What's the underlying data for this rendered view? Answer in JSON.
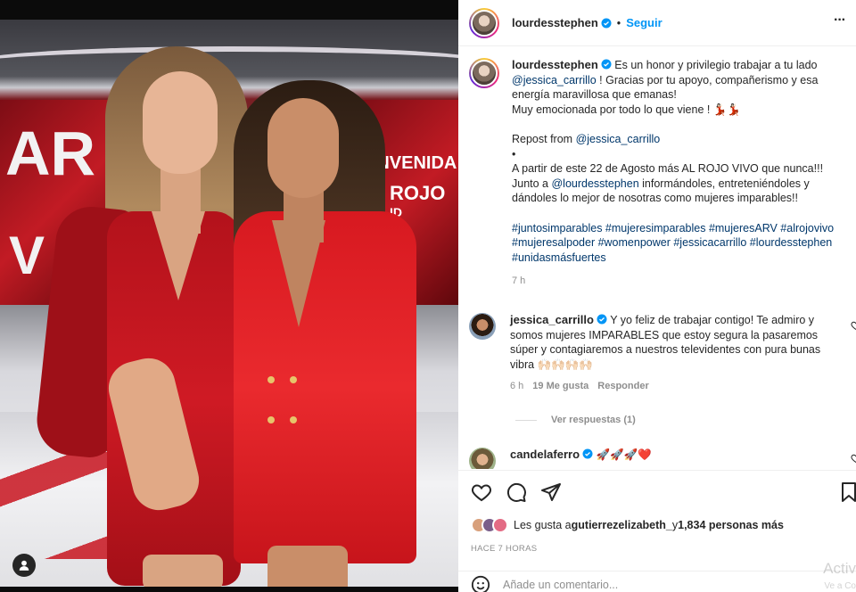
{
  "photo": {
    "screen_left_text": "AR",
    "screen_left_text2": "V",
    "screen_right_text": "ENVENIDA",
    "screen_right_text2": "ROJO",
    "screen_right_text3": "ID"
  },
  "header": {
    "username": "lourdesstephen",
    "separator": "•",
    "follow_label": "Seguir",
    "more_label": "···"
  },
  "caption": {
    "username": "lourdesstephen",
    "line1_text": " Es un honor y privilegio trabajar a tu lado",
    "line2_mention": "@jessica_carrillo",
    "line2_text": " ! Gracias por tu apoyo, compañerismo y esa",
    "line3": "energía maravillosa que emanas!",
    "line4": "Muy emocionada por todo lo que viene ! 💃🏻💃🏻",
    "line5": "",
    "line6_text": "Repost from ",
    "line6_mention": "@jessica_carrillo",
    "line7": "•",
    "line8": "A partir de este 22 de Agosto más AL ROJO VIVO que nunca!!!",
    "line9_text1": "Junto a ",
    "line9_mention": "@lourdesstephen",
    "line9_text2": " informándoles, entreteniéndoles y",
    "line10": "dándoles lo mejor de nosotras como mujeres imparables!!",
    "line11": "",
    "hashtags_line1": "#juntosimparables #mujeresimparables #mujeresARV #alrojovivo",
    "hashtags_line2": "#mujeresalpoder #womenpower #jessicacarrillo #lourdesstephen",
    "hashtags_line3": "#unidasmásfuertes",
    "time": "7 h"
  },
  "comments": [
    {
      "username": "jessica_carrillo",
      "line1": " Y yo feliz de trabajar contigo! Te admiro y",
      "line2": "somos mujeres IMPARABLES que estoy segura la pasaremos",
      "line3": "súper y contagiaremos a nuestros televidentes con pura bunas",
      "line4": "vibra 🙌🏻🙌🏻🙌🏻🙌🏻",
      "time": "6 h",
      "likes": "19 Me gusta",
      "reply_label": "Responder",
      "view_replies": "Ver respuestas (1)"
    },
    {
      "username": "candelaferro",
      "text": " 🚀🚀🚀❤️"
    }
  ],
  "actions": {
    "likes_prefix": "Les gusta a ",
    "likes_user": "gutierrezelizabeth_",
    "likes_middle": " y ",
    "likes_count": "1,834 personas más",
    "date": "HACE 7 HORAS",
    "comment_placeholder": "Añade un comentario..."
  },
  "watermark": {
    "line1": "Activ",
    "line2": "Ve a Co"
  },
  "colors": {
    "link": "#00376b",
    "follow": "#0095f6",
    "verified": "#0095f6",
    "muted": "#8e8e8e"
  }
}
